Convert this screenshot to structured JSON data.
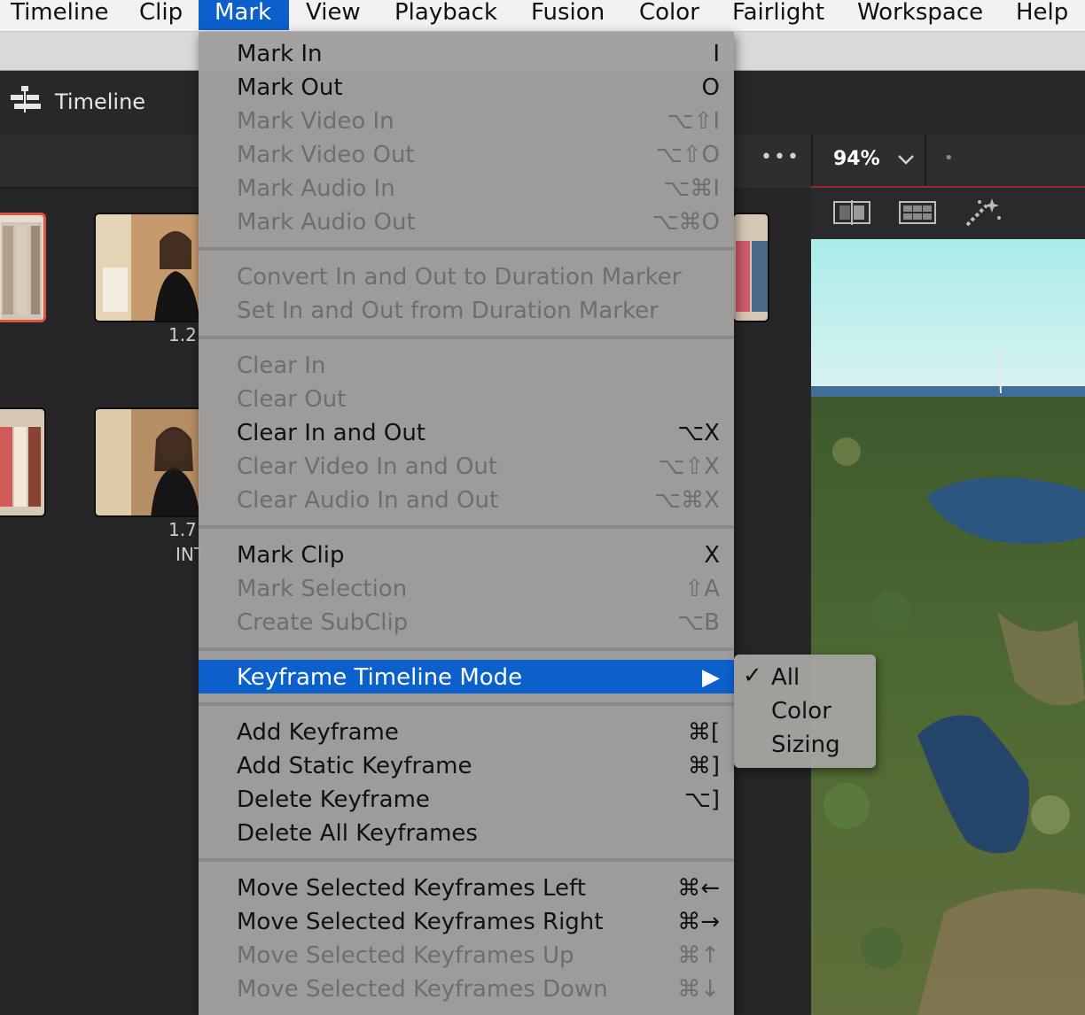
{
  "menubar": {
    "items": [
      {
        "label": "Timeline"
      },
      {
        "label": "Clip"
      },
      {
        "label": "Mark"
      },
      {
        "label": "View"
      },
      {
        "label": "Playback"
      },
      {
        "label": "Fusion"
      },
      {
        "label": "Color"
      },
      {
        "label": "Fairlight"
      },
      {
        "label": "Workspace"
      },
      {
        "label": "Help"
      }
    ]
  },
  "app": {
    "timeline_tab_label": "Timeline"
  },
  "media_pool": {
    "clip_labels": [
      "1.2",
      "1.7",
      "INT"
    ]
  },
  "viewer": {
    "more_label": "•••",
    "zoom": "94%",
    "dot": "•"
  },
  "mark_menu": {
    "items": [
      {
        "label": "Mark In",
        "shortcut": "I"
      },
      {
        "label": "Mark Out",
        "shortcut": "O"
      },
      {
        "label": "Mark Video In",
        "shortcut": "⌥⇧I"
      },
      {
        "label": "Mark Video Out",
        "shortcut": "⌥⇧O"
      },
      {
        "label": "Mark Audio In",
        "shortcut": "⌥⌘I"
      },
      {
        "label": "Mark Audio Out",
        "shortcut": "⌥⌘O"
      },
      {
        "label": "Convert In and Out to Duration Marker",
        "shortcut": ""
      },
      {
        "label": "Set In and Out from Duration Marker",
        "shortcut": ""
      },
      {
        "label": "Clear In",
        "shortcut": ""
      },
      {
        "label": "Clear Out",
        "shortcut": ""
      },
      {
        "label": "Clear In and Out",
        "shortcut": "⌥X"
      },
      {
        "label": "Clear Video In and Out",
        "shortcut": "⌥⇧X"
      },
      {
        "label": "Clear Audio In and Out",
        "shortcut": "⌥⌘X"
      },
      {
        "label": "Mark Clip",
        "shortcut": "X"
      },
      {
        "label": "Mark Selection",
        "shortcut": "⇧A"
      },
      {
        "label": "Create SubClip",
        "shortcut": "⌥B"
      },
      {
        "label": "Keyframe Timeline Mode",
        "shortcut": "▶"
      },
      {
        "label": "Add Keyframe",
        "shortcut": "⌘["
      },
      {
        "label": "Add Static Keyframe",
        "shortcut": "⌘]"
      },
      {
        "label": "Delete Keyframe",
        "shortcut": "⌥]"
      },
      {
        "label": "Delete All Keyframes",
        "shortcut": ""
      },
      {
        "label": "Move Selected Keyframes Left",
        "shortcut": "⌘←"
      },
      {
        "label": "Move Selected Keyframes Right",
        "shortcut": "⌘→"
      },
      {
        "label": "Move Selected Keyframes Up",
        "shortcut": "⌘↑"
      },
      {
        "label": "Move Selected Keyframes Down",
        "shortcut": "⌘↓"
      }
    ]
  },
  "submenu": {
    "checkmark": "✓",
    "items": [
      {
        "label": "All",
        "checked": true
      },
      {
        "label": "Color",
        "checked": false
      },
      {
        "label": "Sizing",
        "checked": false
      }
    ]
  },
  "colors": {
    "highlight": "#0b60cc",
    "selected_clip_border": "#e2533f"
  }
}
